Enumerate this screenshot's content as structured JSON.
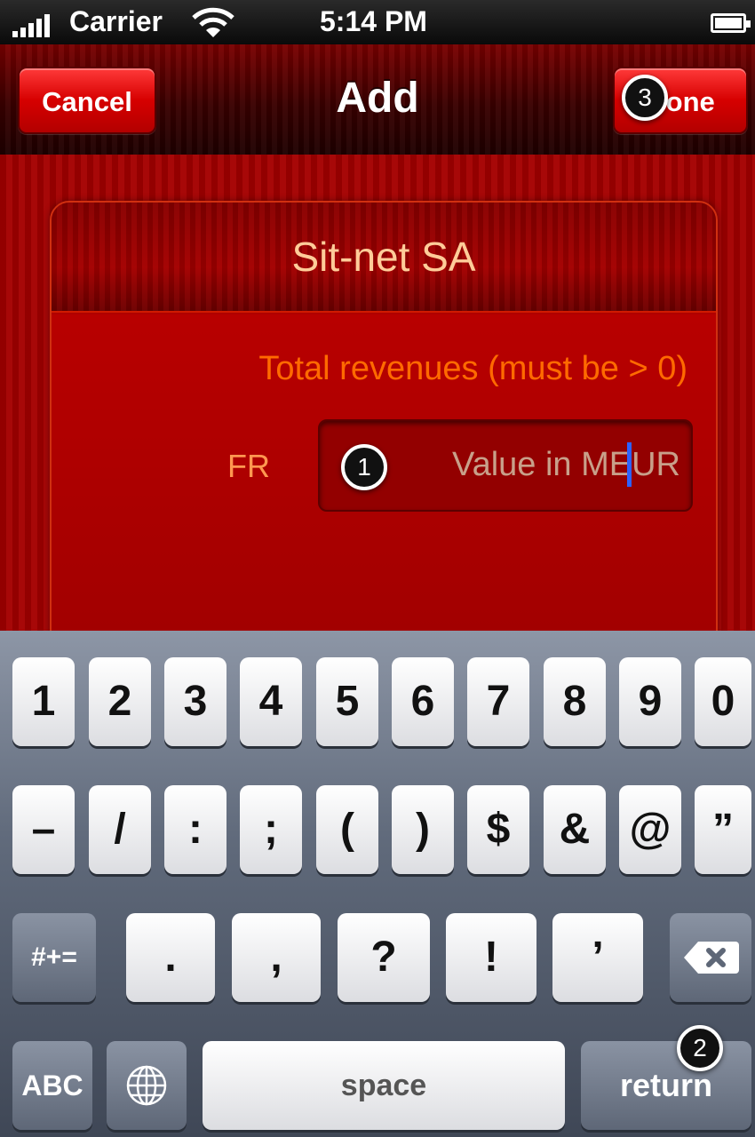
{
  "status_bar": {
    "carrier": "Carrier",
    "time": "5:14 PM"
  },
  "nav": {
    "title": "Add",
    "cancel_label": "Cancel",
    "done_label": "Done"
  },
  "card": {
    "title": "Sit-net SA",
    "field_caption": "Total revenues (must be > 0)",
    "currency_label": "FR",
    "input_placeholder": "Value in MEUR"
  },
  "keyboard": {
    "row1": [
      "1",
      "2",
      "3",
      "4",
      "5",
      "6",
      "7",
      "8",
      "9",
      "0"
    ],
    "row2": [
      "–",
      "/",
      ":",
      ";",
      "(",
      ")",
      "$",
      "&",
      "@",
      "”"
    ],
    "row3": [
      ".",
      ",",
      "?",
      "!",
      "’"
    ],
    "shift_label": "#+=",
    "abc_label": "ABC",
    "space_label": "space",
    "return_label": "return"
  },
  "annotations": [
    "1",
    "2",
    "3"
  ],
  "colors": {
    "theme_red": "#a40000",
    "button_red": "#e00000",
    "caption_orange": "#ff6a00",
    "caret_blue": "#2d62ff"
  }
}
